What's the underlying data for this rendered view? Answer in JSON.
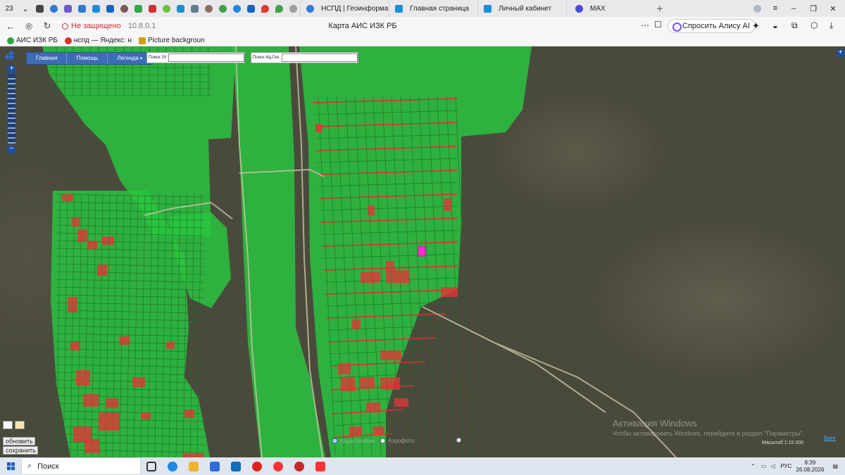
{
  "browser": {
    "tab_count": "23",
    "tabs": [
      {
        "label": "НСПД | Геоинформацион",
        "color": "#2e7bd6"
      },
      {
        "label": "Главная страница",
        "color": "#1a8fd8"
      },
      {
        "label": "Личный кабинет",
        "color": "#1a8fd8"
      },
      {
        "label": "MAX",
        "color": "#4b4bd8"
      }
    ],
    "security_label": "Не защищено",
    "url": "10.8.0.1",
    "page_title": "Карта АИС ИЗК РБ",
    "alice_button": "Спросить Алису AI",
    "bookmarks": [
      {
        "label": "АИС ИЗК РБ",
        "color": "#28a745"
      },
      {
        "label": "нспд — Яндекс: н",
        "color": "#e52d27"
      },
      {
        "label": "Picture backgroun",
        "color": "#d4a017"
      }
    ]
  },
  "map": {
    "toolbar": [
      "Главная",
      "Помощь",
      "Легенда"
    ],
    "search_plot_label": "Поиск ЗУ",
    "search_plot_value": "",
    "search_geo_label": "Поиск Ид.Гео.",
    "search_geo_value": "",
    "refresh_button": "обновить",
    "save_button": "сохранить",
    "layer_labels": [
      "Кадастровые",
      "Аэрофото"
    ],
    "watermark_title": "Активация Windows",
    "watermark_text": "Чтобы активировать Windows, перейдите в раздел \"Параметры\".",
    "scale_text": "Масштаб 1:10 000",
    "scale_link": "Бинг",
    "colors": {
      "parcel_green": "#27d645",
      "parcel_red": "#e23434",
      "highlight": "#ff2bd4",
      "toolbar": "#3d6cb4"
    }
  },
  "taskbar": {
    "search_placeholder": "Поиск",
    "language": "РУС",
    "time": "8:39",
    "date": "26.08.2026"
  }
}
